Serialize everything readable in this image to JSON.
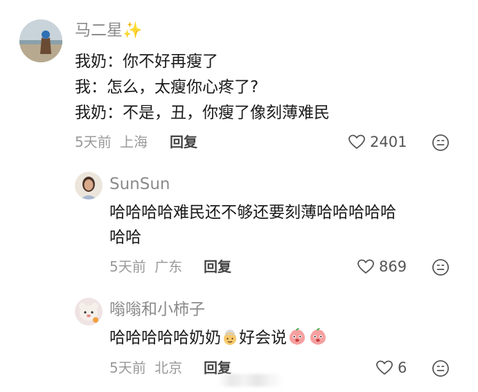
{
  "comments": [
    {
      "username": "马二星",
      "username_emoji": "✨",
      "lines": [
        "我奶：你不好再瘦了",
        "我：怎么，太瘦你心疼了?",
        "我奶：不是，丑，你瘦了像刻薄难民"
      ],
      "time": "5天前",
      "location": "上海",
      "reply_label": "回复",
      "likes": "2401"
    },
    {
      "username": "SunSun",
      "lines": [
        "哈哈哈哈难民还不够还要刻薄哈哈哈哈哈",
        "哈哈"
      ],
      "time": "5天前",
      "location": "广东",
      "reply_label": "回复",
      "likes": "869"
    },
    {
      "username": "嗡嗡和小柿子",
      "line_before_emoji": "哈哈哈哈哈奶奶",
      "line_after_emoji": "好会说",
      "time": "5天前",
      "location": "北京",
      "reply_label": "回复",
      "likes": "6"
    }
  ],
  "icons": {
    "like": "heart-outline-icon",
    "emoji_reaction": "smiley-face-icon",
    "grandma": "grandma-emoji",
    "peach": "peach-face-emoji"
  },
  "colors": {
    "username": "#8a8a8a",
    "text": "#1a1a1a",
    "meta": "#9a9a9a"
  }
}
